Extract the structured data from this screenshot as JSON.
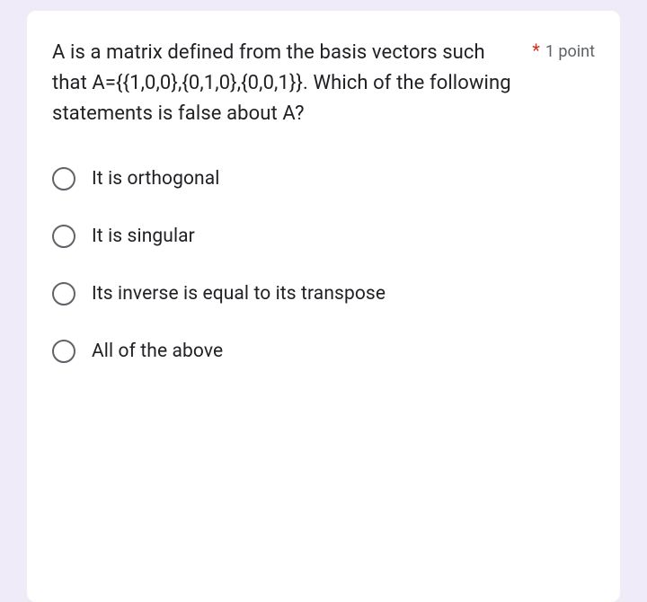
{
  "question": {
    "text": "A is a matrix defined from the basis vectors such that A={{1,0,0},{0,1,0},{0,0,1}}. Which of the following statements is false about A?",
    "required_mark": "*",
    "points": "1 point"
  },
  "options": [
    {
      "label": "It is orthogonal"
    },
    {
      "label": "It is singular"
    },
    {
      "label": "Its inverse is equal to its transpose"
    },
    {
      "label": "All of the above"
    }
  ]
}
